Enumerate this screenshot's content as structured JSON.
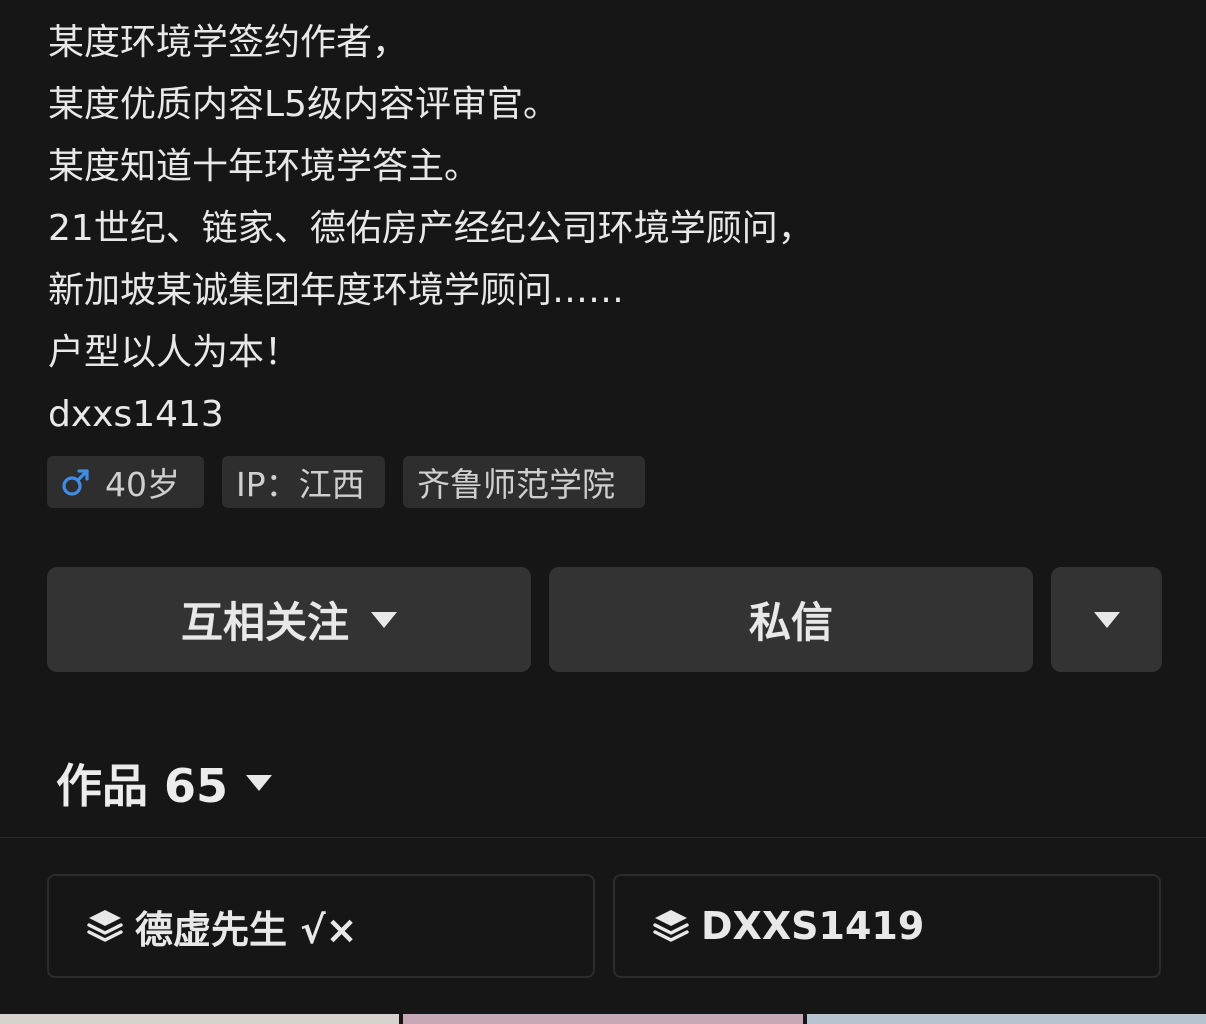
{
  "bio": {
    "lines": [
      "某度环境学签约作者，",
      "某度优质内容L5级内容评审官。",
      "某度知道十年环境学答主。",
      "21世纪、链家、德佑房产经纪公司环境学顾问，",
      "新加坡某诚集团年度环境学顾问……",
      "户型以人为本！",
      "dxxs1413"
    ]
  },
  "tags": {
    "gender_icon": "male-icon",
    "age": "40岁",
    "ip": "IP：江西",
    "school": "齐鲁师范学院"
  },
  "actions": {
    "follow_label": "互相关注",
    "message_label": "私信"
  },
  "works": {
    "label": "作品 65"
  },
  "collections": [
    {
      "icon": "layers-icon",
      "title": "德虚先生 √×"
    },
    {
      "icon": "layers-icon",
      "title": "DXXS1419"
    }
  ],
  "colors": {
    "background": "#161616",
    "tag_bg": "#2e2e2e",
    "button_bg": "#333333",
    "male_icon": "#3d8ee8"
  }
}
